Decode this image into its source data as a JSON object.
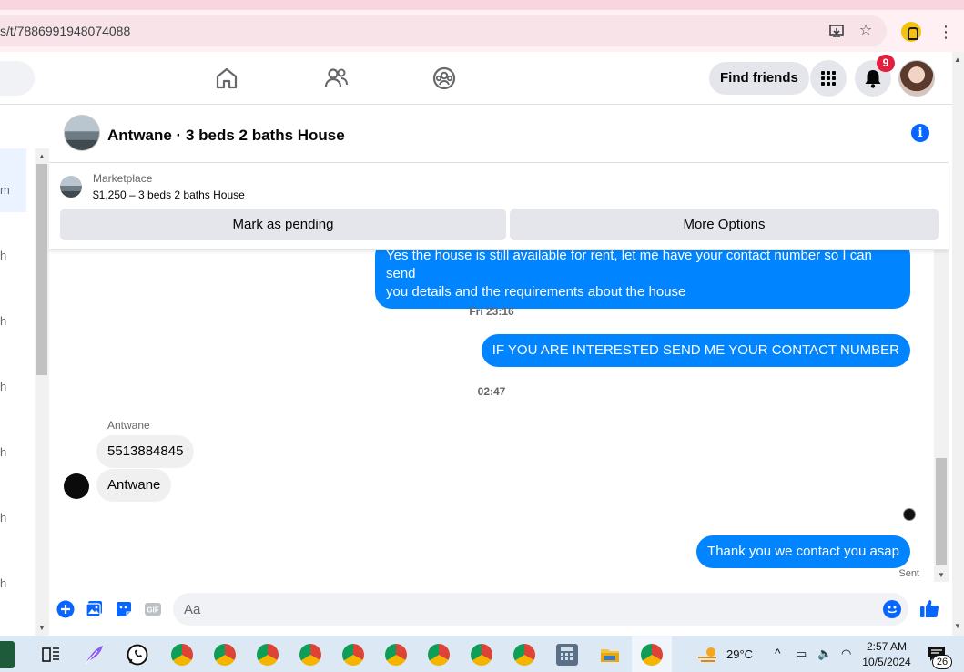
{
  "browser": {
    "url": "s/t/7886991948074088",
    "icons": [
      "install-app-icon",
      "bookmark-star-icon",
      "extension-lock-icon",
      "more-menu-icon"
    ]
  },
  "nav": {
    "icons": [
      "home-icon",
      "friends-icon",
      "groups-icon",
      "menu-grid-icon",
      "notifications-bell-icon"
    ],
    "find_friends_label": "Find friends",
    "notification_count": "9"
  },
  "left_list": {
    "fragments": [
      "m",
      "h",
      "h",
      "h",
      "h",
      "h",
      "h"
    ]
  },
  "conversation": {
    "title": "Antwane · 3 beds 2 baths House",
    "marketplace": {
      "label": "Marketplace",
      "listing": "$1,250 – 3 beds 2 baths House",
      "mark_pending_label": "Mark as pending",
      "more_options_label": "More Options"
    },
    "messages": {
      "m1_line1": "Yes the house is still available for rent, let me have your contact number so I can send",
      "m1_line2": "you details and the requirements about the house",
      "ts1": "Fri 23:16",
      "m2": "IF YOU ARE INTERESTED SEND ME YOUR CONTACT NUMBER",
      "ts2": "02:47",
      "sender": "Antwane",
      "m3": "5513884845",
      "m4": "Antwane",
      "m5": "Thank you we contact you asap",
      "status": "Sent"
    },
    "composer": {
      "placeholder": "Aa",
      "icons": [
        "add-circle-icon",
        "photo-icon",
        "sticker-icon",
        "gif-icon",
        "emoji-icon",
        "like-thumb-icon"
      ],
      "gif_label": "GIF"
    }
  },
  "taskbar": {
    "weather": "29°C",
    "time": "2:57 AM",
    "date": "10/5/2024",
    "notification_count": "26",
    "icons": [
      "task-view-icon",
      "feather-app-icon",
      "whatsapp-icon",
      "chrome-icon",
      "calculator-icon",
      "file-explorer-icon",
      "weather-icon",
      "chevron-up-icon",
      "battery-icon",
      "volume-icon",
      "wifi-icon",
      "notification-center-icon"
    ]
  },
  "colors": {
    "messenger_blue": "#0084ff",
    "fb_blue": "#0866ff",
    "badge_red": "#e41e3f"
  }
}
